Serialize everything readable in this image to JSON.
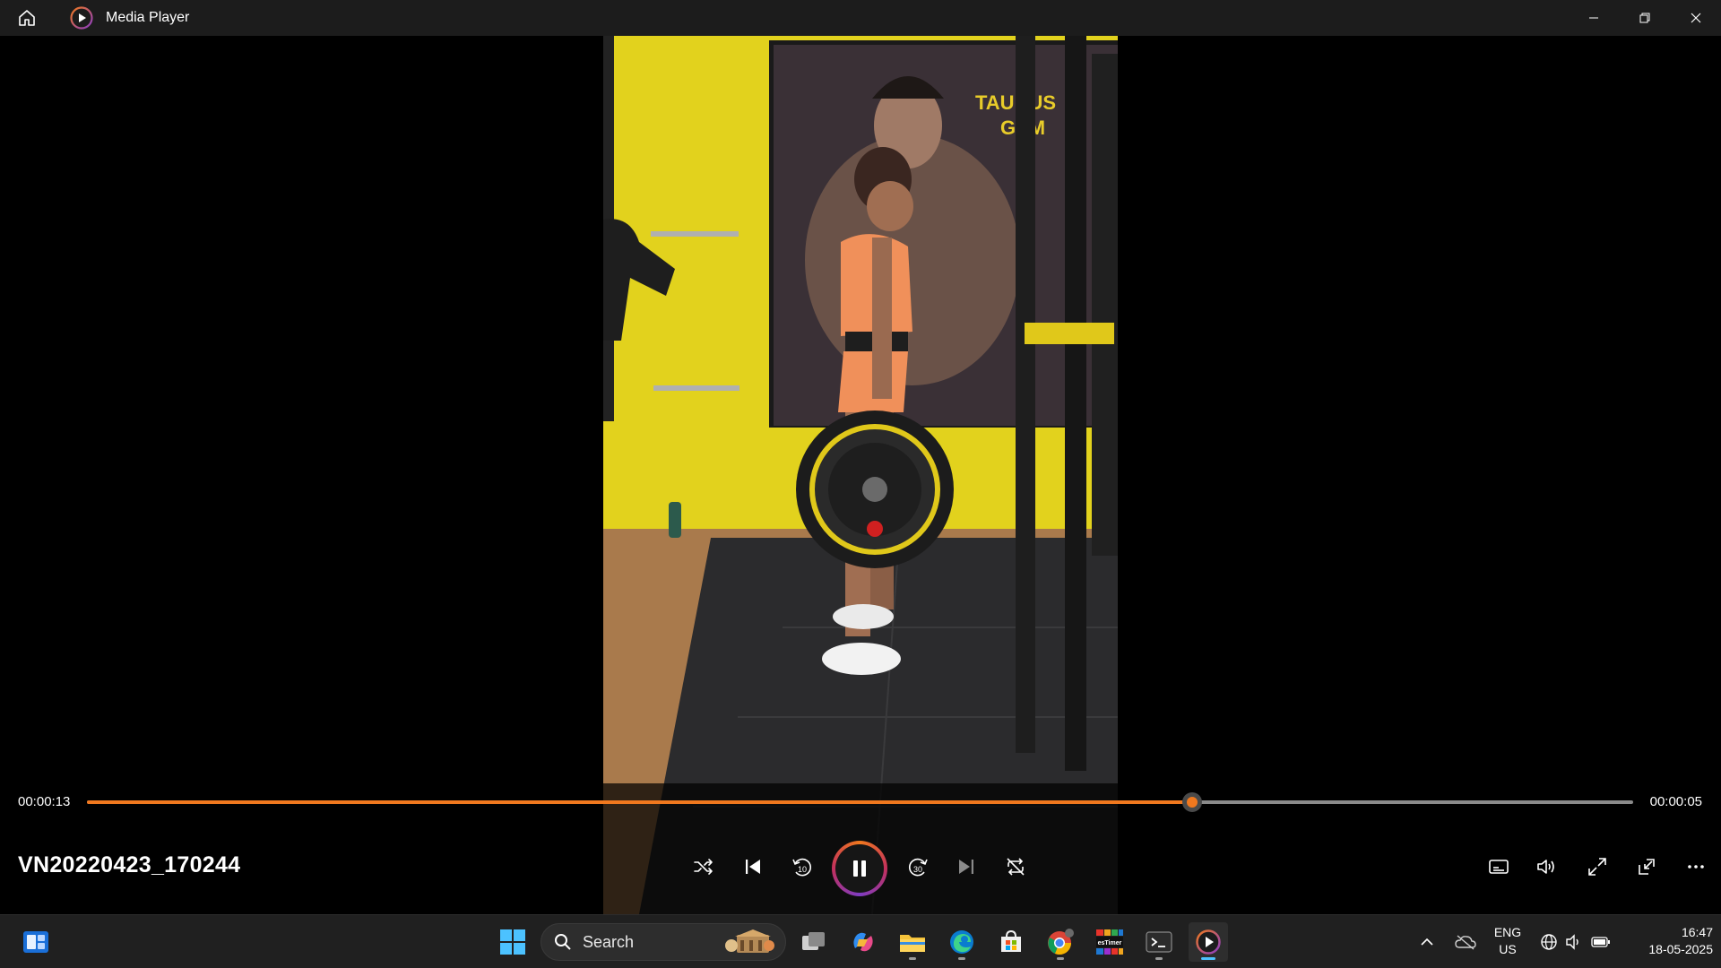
{
  "app": {
    "title": "Media Player"
  },
  "player": {
    "file_name": "VN20220423_170244",
    "time_elapsed": "00:00:13",
    "time_remaining": "00:00:05",
    "progress_fraction": 0.715
  },
  "video": {
    "poster_text_1": "TAURUS",
    "poster_text_2": "GYM"
  },
  "taskbar": {
    "search_label": "Search",
    "language_line1": "ENG",
    "language_line2": "US",
    "time": "16:47",
    "date": "18-05-2025",
    "app_tile_label": "esTimer"
  },
  "colors": {
    "accent": "#f0781e",
    "taskbar_indicator": "#4cc2ff",
    "background": "#000000"
  }
}
